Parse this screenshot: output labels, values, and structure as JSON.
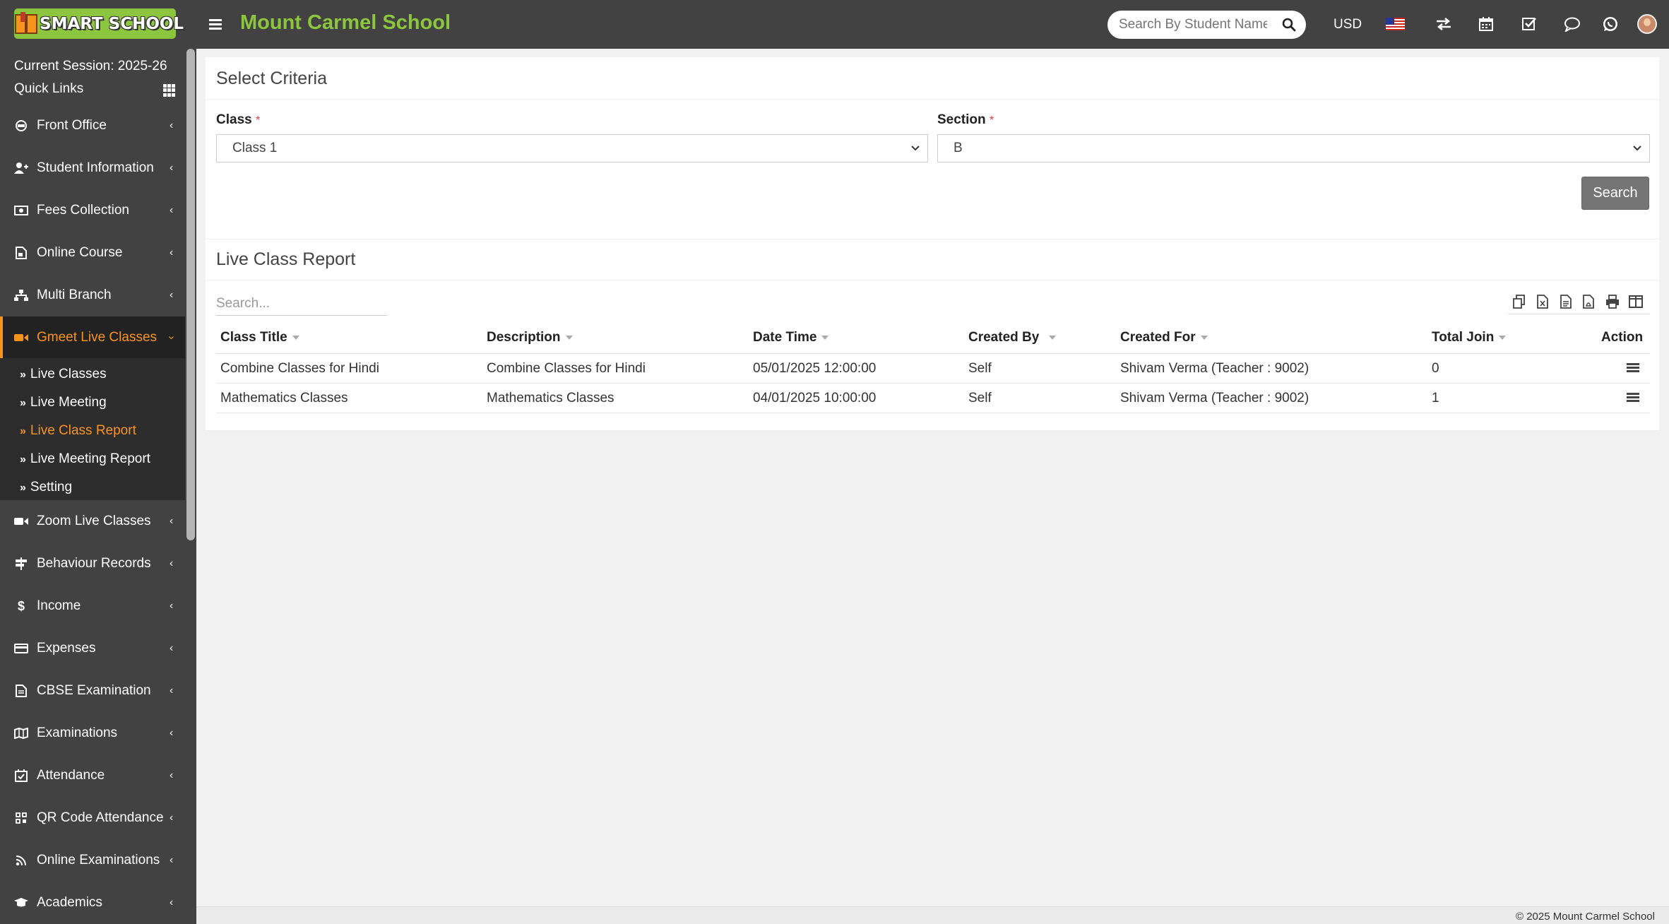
{
  "header": {
    "logo_text": "SMART SCHOOL",
    "school_name": "Mount Carmel School",
    "search_placeholder": "Search By Student Name",
    "currency": "USD"
  },
  "sidebar": {
    "session": "Current Session: 2025-26",
    "quick_links": "Quick Links",
    "items": [
      {
        "label": "Front Office",
        "icon": "headset-icon"
      },
      {
        "label": "Student Information",
        "icon": "user-plus-icon"
      },
      {
        "label": "Fees Collection",
        "icon": "money-icon"
      },
      {
        "label": "Online Course",
        "icon": "file-video-icon"
      },
      {
        "label": "Multi Branch",
        "icon": "sitemap-icon"
      },
      {
        "label": "Gmeet Live Classes",
        "icon": "video-icon"
      },
      {
        "label": "Zoom Live Classes",
        "icon": "video-icon"
      },
      {
        "label": "Behaviour Records",
        "icon": "signpost-icon"
      },
      {
        "label": "Income",
        "icon": "dollar-icon"
      },
      {
        "label": "Expenses",
        "icon": "credit-card-icon"
      },
      {
        "label": "CBSE Examination",
        "icon": "file-text-icon"
      },
      {
        "label": "Examinations",
        "icon": "map-icon"
      },
      {
        "label": "Attendance",
        "icon": "calendar-check-icon"
      },
      {
        "label": "QR Code Attendance",
        "icon": "qrcode-icon"
      },
      {
        "label": "Online Examinations",
        "icon": "rss-icon"
      },
      {
        "label": "Academics",
        "icon": "graduation-cap-icon"
      }
    ],
    "submenu": [
      {
        "label": "Live Classes"
      },
      {
        "label": "Live Meeting"
      },
      {
        "label": "Live Class Report"
      },
      {
        "label": "Live Meeting Report"
      },
      {
        "label": "Setting"
      }
    ]
  },
  "criteria": {
    "title": "Select Criteria",
    "class_label": "Class",
    "class_value": "Class 1",
    "section_label": "Section",
    "section_value": "B",
    "required_mark": "*",
    "search_button": "Search"
  },
  "report": {
    "title": "Live Class Report",
    "search_placeholder": "Search...",
    "columns": [
      "Class Title",
      "Description",
      "Date Time",
      "Created By",
      "Created For",
      "Total Join",
      "Action"
    ],
    "rows": [
      {
        "class_title": "Combine Classes for Hindi",
        "description": "Combine Classes for Hindi",
        "date_time": "05/01/2025 12:00:00",
        "created_by": "Self",
        "created_for": "Shivam Verma (Teacher : 9002)",
        "total_join": "0"
      },
      {
        "class_title": "Mathematics Classes",
        "description": "Mathematics Classes",
        "date_time": "04/01/2025 10:00:00",
        "created_by": "Self",
        "created_for": "Shivam Verma (Teacher : 9002)",
        "total_join": "1"
      }
    ]
  },
  "footer": {
    "copyright": "© 2025 Mount Carmel School"
  },
  "colors": {
    "header_bg": "#424242",
    "brand_green": "#8cc63f",
    "accent_orange": "#f7941d"
  }
}
